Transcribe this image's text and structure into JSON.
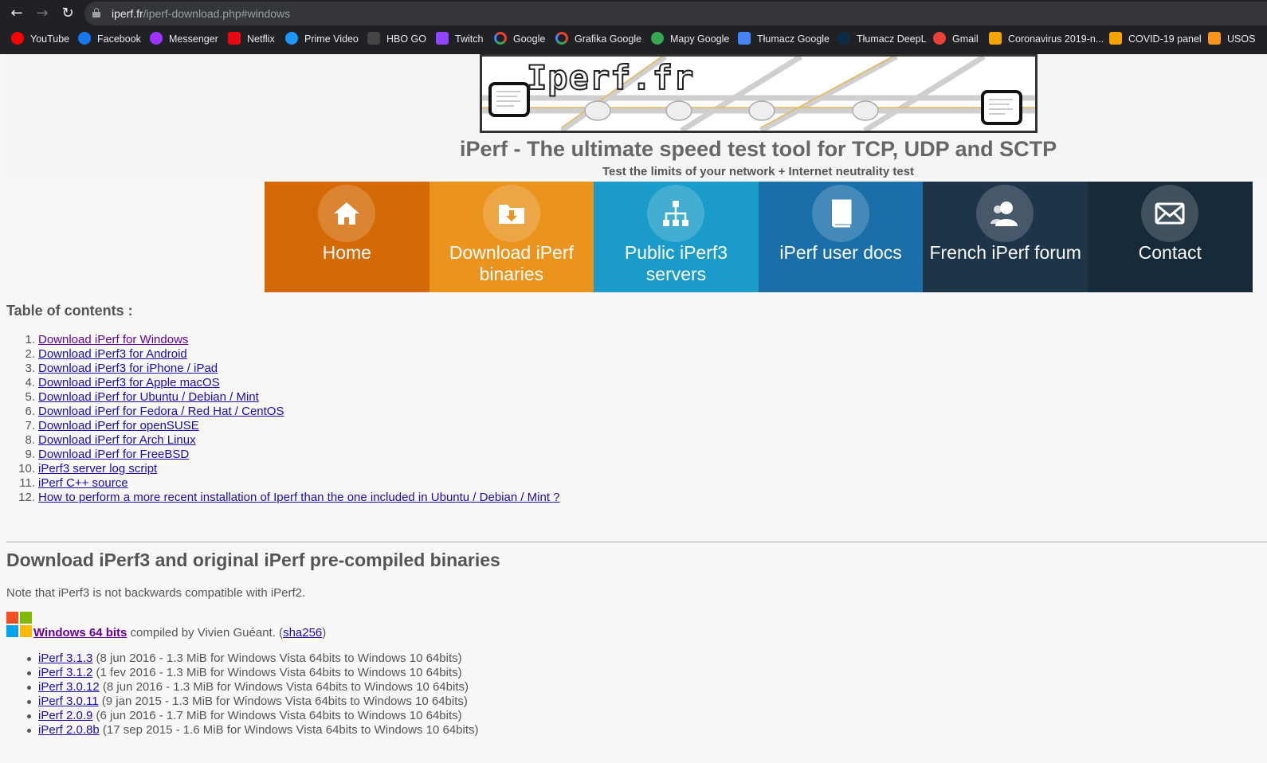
{
  "browser": {
    "url_host": "iperf.fr",
    "url_path": "/iperf-download.php#windows",
    "bookmarks": [
      {
        "label": "YouTube",
        "icon": "youtube-icon",
        "color": "#ff0000"
      },
      {
        "label": "Facebook",
        "icon": "facebook-icon",
        "color": "#1877f2"
      },
      {
        "label": "Messenger",
        "icon": "messenger-icon",
        "color": "#a033ff"
      },
      {
        "label": "Netflix",
        "icon": "netflix-icon",
        "color": "#e50914"
      },
      {
        "label": "Prime Video",
        "icon": "prime-video-icon",
        "color": "#1a98ff"
      },
      {
        "label": "HBO GO",
        "icon": "hbo-go-icon",
        "color": "#444444"
      },
      {
        "label": "Twitch",
        "icon": "twitch-icon",
        "color": "#9146ff"
      },
      {
        "label": "Google",
        "icon": "google-icon",
        "color": "#ffffff"
      },
      {
        "label": "Grafika Google",
        "icon": "google-icon",
        "color": "#ffffff"
      },
      {
        "label": "Mapy Google",
        "icon": "maps-icon",
        "color": "#34a853"
      },
      {
        "label": "Tłumacz Google",
        "icon": "translate-icon",
        "color": "#4285f4"
      },
      {
        "label": "Tłumacz DeepL",
        "icon": "deepl-icon",
        "color": "#0f2b46"
      },
      {
        "label": "Gmail",
        "icon": "gmail-icon",
        "color": "#ea4335"
      },
      {
        "label": "Coronavirus 2019-n...",
        "icon": "dashboard-icon",
        "color": "#f4a300"
      },
      {
        "label": "COVID-19 panel",
        "icon": "dashboard-icon",
        "color": "#f4a300"
      },
      {
        "label": "USOS",
        "icon": "usos-icon",
        "color": "#f7941d"
      }
    ]
  },
  "header": {
    "banner_text": "Iperf.fr",
    "title": "iPerf - The ultimate speed test tool for TCP, UDP and SCTP",
    "subtitle": "Test the limits of your network + Internet neutrality test"
  },
  "menu": [
    {
      "label": "Home",
      "icon": "home-icon",
      "color": "#d46a06"
    },
    {
      "label": "Download iPerf binaries",
      "icon": "download-folder-icon",
      "color": "#ea931d"
    },
    {
      "label": "Public iPerf3 servers",
      "icon": "network-icon",
      "color": "#1a9bc9"
    },
    {
      "label": "iPerf user docs",
      "icon": "book-icon",
      "color": "#1b6fa8"
    },
    {
      "label": "French iPerf forum",
      "icon": "users-icon",
      "color": "#1e3448"
    },
    {
      "label": "Contact",
      "icon": "envelope-icon",
      "color": "#172a39"
    }
  ],
  "toc": {
    "title": "Table of contents :",
    "items": [
      "Download iPerf for Windows",
      "Download iPerf3 for Android",
      "Download iPerf3 for iPhone / iPad",
      "Download iPerf3 for Apple macOS",
      "Download iPerf for Ubuntu / Debian / Mint",
      "Download iPerf for Fedora / Red Hat / CentOS",
      "Download iPerf for openSUSE",
      "Download iPerf for Arch Linux",
      "Download iPerf for FreeBSD",
      "iPerf3 server log script",
      "iPerf C++ source",
      "How to perform a more recent installation of Iperf than the one included in Ubuntu / Debian / Mint ?"
    ]
  },
  "section": {
    "heading": "Download iPerf3 and original iPerf pre-compiled binaries",
    "note": "Note that iPerf3 is not backwards compatible with iPerf2.",
    "windows_link": "Windows 64 bits",
    "compiled_by": " compiled by Vivien Guéant. (",
    "sha_link": "sha256",
    "sha_close": ")",
    "versions": [
      {
        "name": "iPerf 3.1.3",
        "desc": " (8 jun 2016 - 1.3 MiB for Windows Vista 64bits to Windows 10 64bits)"
      },
      {
        "name": "iPerf 3.1.2",
        "desc": " (1 fev 2016 - 1.3 MiB for Windows Vista 64bits to Windows 10 64bits)"
      },
      {
        "name": "iPerf 3.0.12",
        "desc": " (8 jun 2016 - 1.3 MiB for Windows Vista 64bits to Windows 10 64bits)"
      },
      {
        "name": "iPerf 3.0.11",
        "desc": " (9 jan 2015 - 1.3 MiB for Windows Vista 64bits to Windows 10 64bits)"
      },
      {
        "name": "iPerf 2.0.9",
        "desc": " (6 jun 2016 - 1.7 MiB for Windows Vista 64bits to Windows 10 64bits)"
      },
      {
        "name": "iPerf 2.0.8b",
        "desc": " (17 sep 2015 - 1.6 MiB for Windows Vista 64bits to Windows 10 64bits)"
      }
    ]
  }
}
